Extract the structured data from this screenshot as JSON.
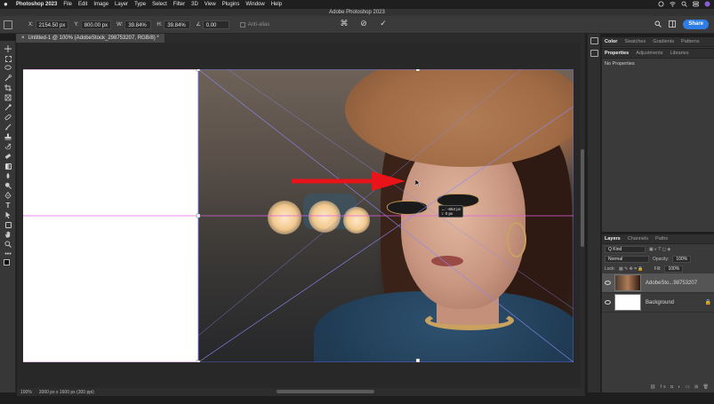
{
  "menubar": {
    "app_name": "Photoshop 2023",
    "items": [
      "File",
      "Edit",
      "Image",
      "Layer",
      "Type",
      "Select",
      "Filter",
      "3D",
      "View",
      "Plugins",
      "Window",
      "Help"
    ]
  },
  "window_title": "Adobe Photoshop 2023",
  "options": {
    "x_label": "X:",
    "x_value": "2154.50 px",
    "y_label": "Y:",
    "y_value": "800.00 px",
    "w_label": "W:",
    "w_value": "39.84%",
    "h_label": "H:",
    "h_value": "39.84%",
    "angle_value": "0.00",
    "antialias_label": "Anti-alias",
    "share_label": "Share"
  },
  "document_tab": {
    "title": "Untitled-1 @ 100% (AdobeStock_298753207, RGB/8) *",
    "close": "×"
  },
  "hud": {
    "line1": "↔: -654 px",
    "line2": "↕:      0 px"
  },
  "panels": {
    "top_tabs": [
      "Color",
      "Swatches",
      "Gradients",
      "Patterns"
    ],
    "properties_tabs": [
      "Properties",
      "Adjustments",
      "Libraries"
    ],
    "properties_empty": "No Properties",
    "layers_tabs": [
      "Layers",
      "Channels",
      "Paths"
    ],
    "kind_label": "Q Kind",
    "blend_mode": "Normal",
    "opacity_label": "Opacity:",
    "opacity_value": "100%",
    "lock_label": "Lock:",
    "fill_label": "Fill:",
    "fill_value": "100%",
    "layers": [
      {
        "name": "AdobeSto...98753207"
      },
      {
        "name": "Background"
      }
    ]
  },
  "status": {
    "zoom": "100%",
    "doc_info": "3000 px x 1600 px (300 ppi)"
  },
  "colors": {
    "accent": "#2f7ee6",
    "guide": "#e060e0",
    "transform_line": "#6a6af0",
    "arrow": "#e8141a"
  },
  "icons": {
    "toolbar": [
      "move-icon",
      "marquee-icon",
      "lasso-icon",
      "quick-select-icon",
      "crop-icon",
      "frame-icon",
      "eyedropper-icon",
      "healing-icon",
      "brush-icon",
      "clone-stamp-icon",
      "history-brush-icon",
      "eraser-icon",
      "gradient-icon",
      "blur-icon",
      "dodge-icon",
      "pen-icon",
      "type-icon",
      "path-select-icon",
      "rectangle-icon",
      "hand-icon",
      "zoom-icon",
      "more-tools-icon"
    ]
  }
}
